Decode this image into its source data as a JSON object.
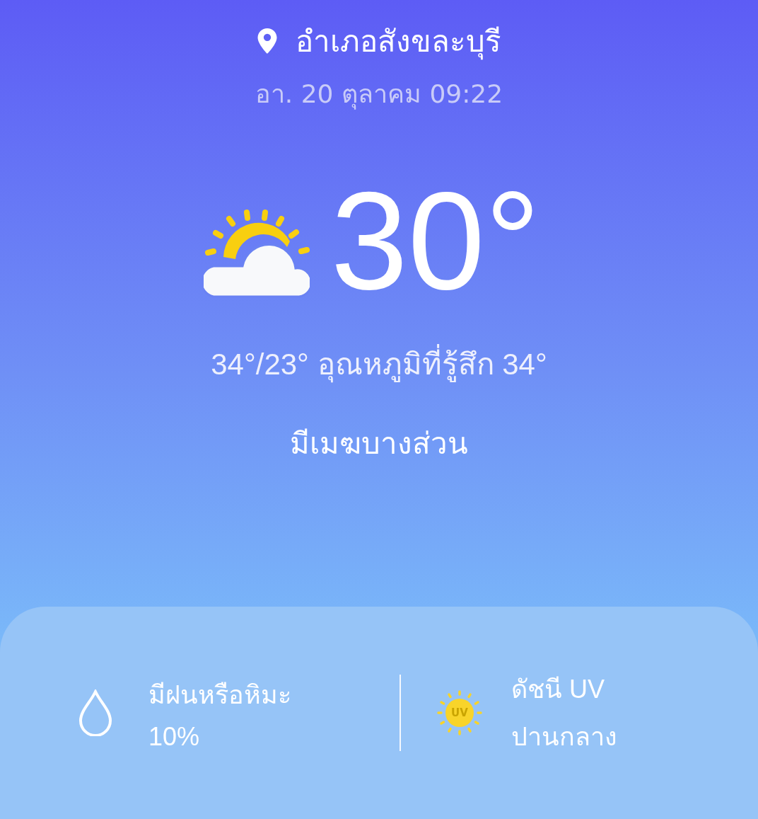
{
  "location": {
    "name": "อำเภอสังขละบุรี"
  },
  "updated": "อา. 20 ตุลาคม 09:22",
  "current": {
    "kind": "partly_cloudy",
    "temperature": "30°",
    "high_low_feels": "34°/23° อุณหภูมิที่รู้สึก 34°",
    "condition": "มีเมฆบางส่วน"
  },
  "details": [
    {
      "kind": "precipitation",
      "label": "มีฝนหรือหิมะ",
      "value": "10%"
    },
    {
      "kind": "uv",
      "icon_text": "UV",
      "label": "ดัชนี UV",
      "value": "ปานกลาง"
    }
  ]
}
